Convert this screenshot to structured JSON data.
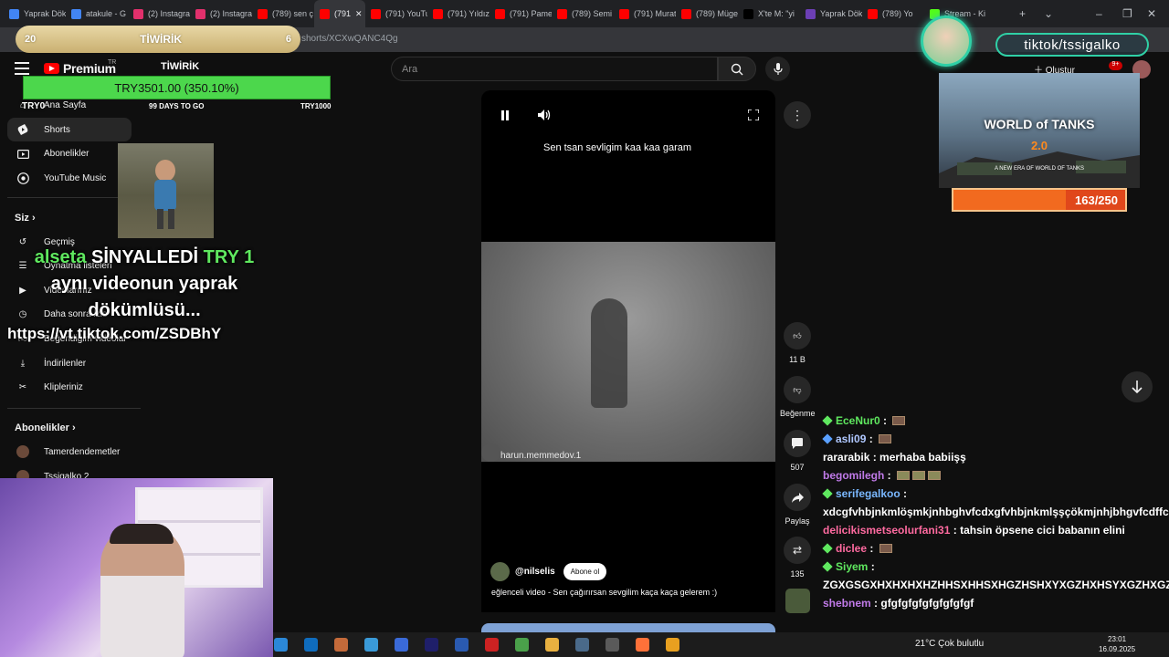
{
  "browser": {
    "tabs": [
      {
        "label": "Yaprak Dök",
        "color": "#4285f4"
      },
      {
        "label": "atakule - G",
        "color": "#4285f4"
      },
      {
        "label": "(2) Instagra",
        "color": "#e1306c"
      },
      {
        "label": "(2) Instagra",
        "color": "#e1306c"
      },
      {
        "label": "(789) sen ç",
        "color": "#ff0000"
      },
      {
        "label": "(791",
        "color": "#ff0000",
        "active": true
      },
      {
        "label": "(791) YouTu",
        "color": "#ff0000"
      },
      {
        "label": "(791) Yıldız",
        "color": "#ff0000"
      },
      {
        "label": "(791) Pame",
        "color": "#ff0000"
      },
      {
        "label": "(789) Semi",
        "color": "#ff0000"
      },
      {
        "label": "(791) Murat",
        "color": "#ff0000"
      },
      {
        "label": "(789) Müge",
        "color": "#ff0000"
      },
      {
        "label": "X'te M: \"yi",
        "color": "#000000"
      },
      {
        "label": "Yaprak Dök",
        "color": "#6c3fb5"
      },
      {
        "label": "(789) Yo",
        "color": "#ff0000"
      },
      {
        "label": "Stream - Ki",
        "color": "#53fc18"
      }
    ],
    "url": "shorts/XCXwQANC4Qg"
  },
  "youtube": {
    "logo": "Premium",
    "region": "TR",
    "search_placeholder": "Ara",
    "create_label": "Oluştur",
    "notifications": "9+",
    "sidebar": {
      "home": "Ana Sayfa",
      "shorts": "Shorts",
      "subscriptions": "Abonelikler",
      "music": "YouTube Music",
      "you_header": "Siz",
      "you_items": [
        "Geçmiş",
        "Oynatma listeleri",
        "Videolarınız",
        "Daha sonra izle",
        "Beğendiğim videolar",
        "İndirilenler",
        "Klipleriniz"
      ],
      "subs_header": "Abonelikler",
      "subs_items": [
        "Tamerdendemetler",
        "Tssigalko 2"
      ]
    },
    "short": {
      "caption": "Sen tsan sevligim kaa kaa garam",
      "watermark": "harun.memmedov.1",
      "channel": "@nilselis",
      "subscribe": "Abone ol",
      "description": "eğlenceli video - Sen çağırırsan sevgilim kaça kaça gelerem :)",
      "likes": "11 B",
      "dislike": "Beğenme",
      "comments": "507",
      "share": "Paylaş",
      "remix": "135"
    }
  },
  "overlays": {
    "goal_left": "20",
    "goal_name": "TİWİRİK",
    "goal_right": "6",
    "tiwirik": "TİWİRİK",
    "goal_bar": "TRY3501.00 (350.10%)",
    "try0": "TRY0",
    "days_left": "99 DAYS TO GO",
    "goal_target": "TRY1000",
    "alert_user": "alseta",
    "alert_action": "SİNYALLEDİ",
    "alert_amount": "TRY 1",
    "alert_message_1": "aynı videonun yaprak",
    "alert_message_2": "dökümlüsü...",
    "alert_link": "https://vt.tiktok.com/ZSDBhY",
    "tiktok_handle": "tiktok/tssigalko",
    "wot_title": "WORLD of TANKS",
    "wot_version": "2.0",
    "wot_tagline": "A NEW ERA OF WORLD OF TANKS",
    "sub_goal": "163/250",
    "sub_goal_progress": 0.652
  },
  "chat": [
    {
      "user": "EceNur0",
      "color": "#5fe85f",
      "text": "",
      "badge": "#5fe85f",
      "emotes": [
        "box"
      ]
    },
    {
      "user": "asli09",
      "color": "#b0c8ff",
      "text": "",
      "badge": "#5aa0ff",
      "emotes": [
        "box"
      ]
    },
    {
      "user": "rararabik",
      "color": "#ffffff",
      "text": "merhaba babiişş",
      "badge": "",
      "emotes": []
    },
    {
      "user": "begomilegh",
      "color": "#c07ae8",
      "text": "",
      "badge": "",
      "emotes": [
        "tile",
        "tile",
        "tile"
      ]
    },
    {
      "user": "serifegalkoo",
      "color": "#7ab8ff",
      "text": "xdcgfvhbjnkmlöşmkjnhbghvfcdxgfvhbjnkmlşşçökmjnhjbhgvfcdffcgfvhbjnkk",
      "badge": "#5fe85f",
      "emotes": []
    },
    {
      "user": "delicikismetseolurfani31",
      "color": "#ff6aa0",
      "text": "tahsin öpsene cici babanın elini",
      "badge": "",
      "emotes": []
    },
    {
      "user": "diclee",
      "color": "#ff6aa0",
      "text": "",
      "badge": "#5fe85f",
      "emotes": [
        "box"
      ]
    },
    {
      "user": "Siyem",
      "color": "#5fe85f",
      "text": "ZGXGSGXHXHXHXHZHHSXHHSXHGZHSHXYXGZHXHSYXGZHXGZ",
      "badge": "#5fe85f",
      "emotes": []
    },
    {
      "user": "shebnem",
      "color": "#c07ae8",
      "text": "gfgfgfgfgfgfgfgfgf",
      "badge": "",
      "emotes": []
    }
  ],
  "taskbar": {
    "weather": "21°C  Çok bulutlu",
    "time": "23:01",
    "date": "16.09.2025",
    "icon_colors": [
      "#2b88d8",
      "#0f6cbd",
      "#c46a3a",
      "#3a9ad8",
      "#3a6ad8",
      "#1f1f6a",
      "#2a5ab0",
      "#cc2222",
      "#4aa04a",
      "#e8b040",
      "#4a6a8a",
      "#5a5a5a",
      "#ff7139",
      "#e8a020"
    ]
  }
}
